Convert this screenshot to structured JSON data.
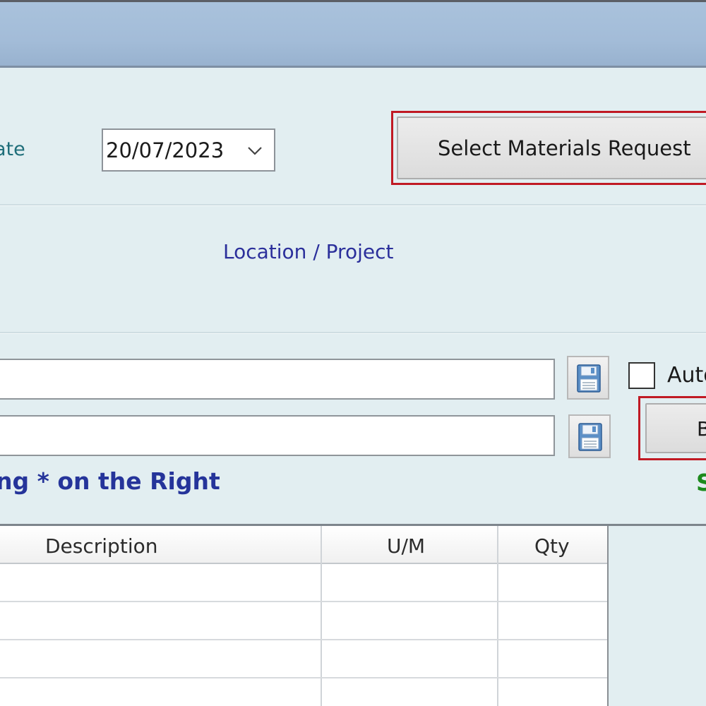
{
  "form": {
    "date_label": "ate",
    "date_value": "20/07/2023",
    "select_materials_request_label": "Select Materials Request",
    "location_project_label": "Location / Project",
    "auto_label": "Auto",
    "b_label": "B",
    "hint_text": "ng * on the Right",
    "s_text": "S",
    "input_1_value": "",
    "input_2_value": ""
  },
  "grid": {
    "columns": [
      "Description",
      "U/M",
      "Qty"
    ],
    "rows": [
      [
        "",
        "",
        ""
      ],
      [
        "",
        "",
        ""
      ],
      [
        "",
        "",
        ""
      ],
      [
        "",
        "",
        ""
      ]
    ]
  },
  "colors": {
    "background": "#e2eef1",
    "title_bar": "#a3bcd8",
    "highlight_red": "#c01a24",
    "label_teal": "#1f6e7a",
    "label_blue": "#2b2f9b",
    "hint_blue": "#25349a",
    "status_green": "#1d8a1d"
  },
  "icons": {
    "save": "floppy-disk-icon",
    "date_dropdown": "chevron-down-icon"
  }
}
